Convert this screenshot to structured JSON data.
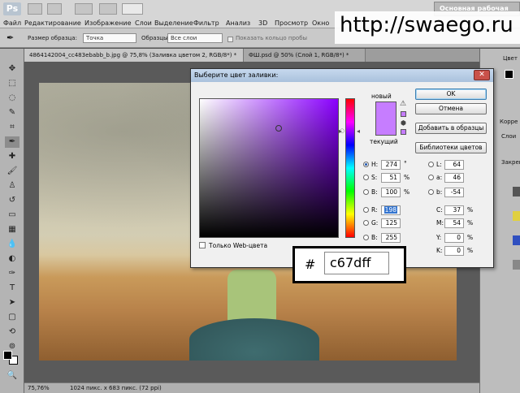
{
  "app": {
    "logo": "Ps",
    "workspace": "Основная рабочая среда"
  },
  "menu": [
    "Файл",
    "Редактирование",
    "Изображение",
    "Слои",
    "Выделение",
    "Фильтр",
    "Анализ",
    "3D",
    "Просмотр",
    "Окно"
  ],
  "options": {
    "sample_size_label": "Размер образца:",
    "sample_size_value": "Точка",
    "samples_label": "Образцы:",
    "samples_value": "Все слои",
    "show_ring_label": "Показать кольцо пробы"
  },
  "tabs": [
    {
      "label": "4864142004_cc483ebabb_b.jpg @ 75,8% (Заливка цветом 2, RGB/8*) *"
    },
    {
      "label": "ФШ.psd @ 50% (Слой 1, RGB/8*) *"
    }
  ],
  "watermark": "http://swaego.ru",
  "status": {
    "zoom": "75,76%",
    "info": "1024 пикс. x 683 пикс. (72 ppi)"
  },
  "panels": {
    "color": "Цвет",
    "corr": "Корре",
    "layers": "Слои",
    "lock": "Закреп"
  },
  "dialog": {
    "title": "Выберите цвет заливки:",
    "new_label": "новый",
    "current_label": "текущий",
    "buttons": {
      "ok": "OK",
      "cancel": "Отмена",
      "add_swatch": "Добавить в образцы",
      "libraries": "Библиотеки цветов"
    },
    "web_only": "Только Web-цвета",
    "hsb": {
      "h": "274",
      "s": "51",
      "b": "100"
    },
    "rgb": {
      "r": "198",
      "g": "125",
      "b": "255"
    },
    "lab": {
      "l": "64",
      "a": "46",
      "b": "-54"
    },
    "cmyk": {
      "c": "37",
      "m": "54",
      "y": "0",
      "k": "0"
    },
    "labels": {
      "h": "H:",
      "s": "S:",
      "b": "B:",
      "r": "R:",
      "g": "G:",
      "bb": "B:",
      "l": "L:",
      "a": "a:",
      "lb": "b:",
      "c": "C:",
      "m": "M:",
      "y": "Y:",
      "k": "K:"
    },
    "units": {
      "deg": "°",
      "pct": "%"
    }
  },
  "hex": {
    "hash": "#",
    "value": "c67dff"
  },
  "colors": {
    "selected": "#c67dff"
  }
}
